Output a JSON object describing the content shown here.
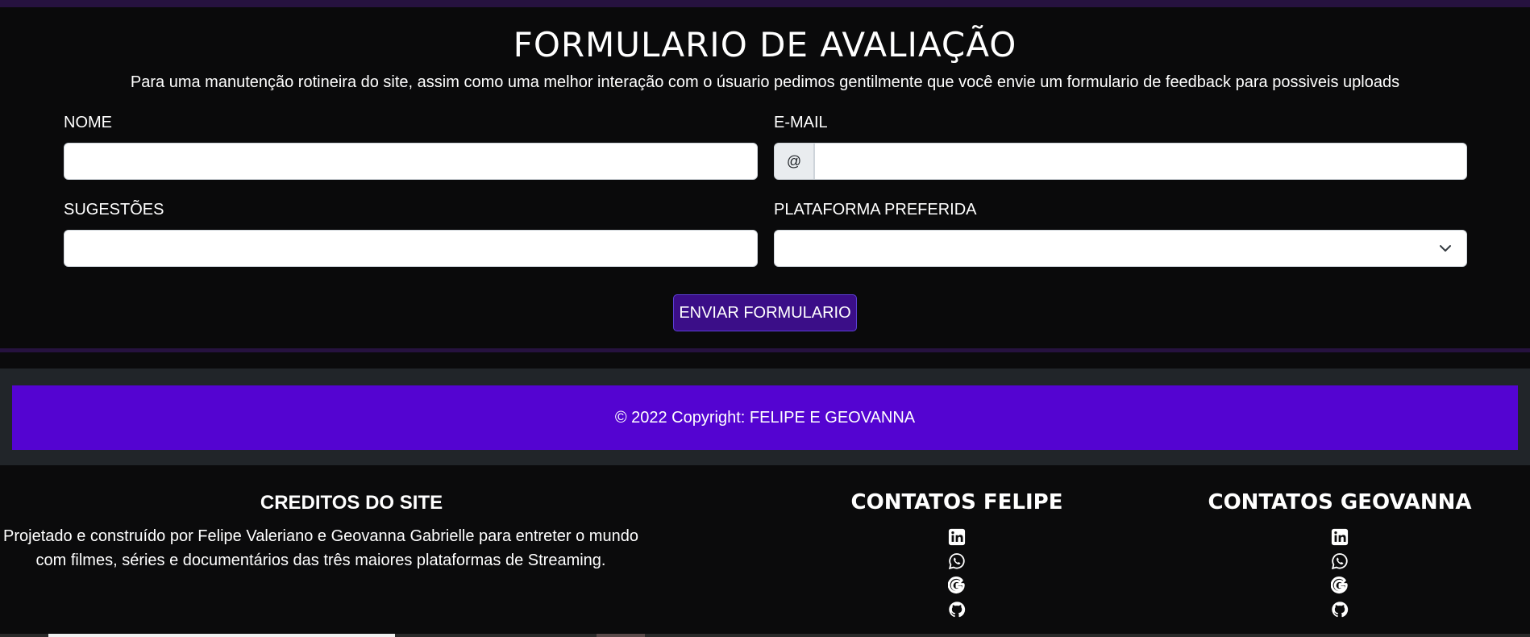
{
  "form": {
    "title": "FORMULARIO DE AVALIAÇÃO",
    "subtitle": "Para uma manutenção rotineira do site, assim como uma melhor interação com o úsuario pedimos gentilmente que você envie um formulario de feedback para possiveis uploads",
    "name_label": "NOME",
    "name_value": "",
    "email_label": "E-MAIL",
    "email_addon": "@",
    "email_value": "",
    "suggestions_label": "SUGESTÕES",
    "suggestions_value": "",
    "platform_label": "PLATAFORMA PREFERIDA",
    "platform_selected": "",
    "submit_label": "ENVIAR FORMULARIO"
  },
  "footer": {
    "copyright": "© 2022 Copyright: FELIPE E GEOVANNA",
    "accent_color": "#5404d1"
  },
  "credits": {
    "title": "CREDITOS DO SITE",
    "text": "Projetado e construído por Felipe Valeriano e Geovanna Gabrielle para entreter o mundo com filmes, séries e documentários das três maiores plataformas de Streaming."
  },
  "contacts": {
    "felipe_title": "CONTATOS FELIPE",
    "geovanna_title": "CONTATOS GEOVANNA",
    "icons": [
      "linkedin-icon",
      "whatsapp-icon",
      "google-icon",
      "github-icon"
    ]
  }
}
